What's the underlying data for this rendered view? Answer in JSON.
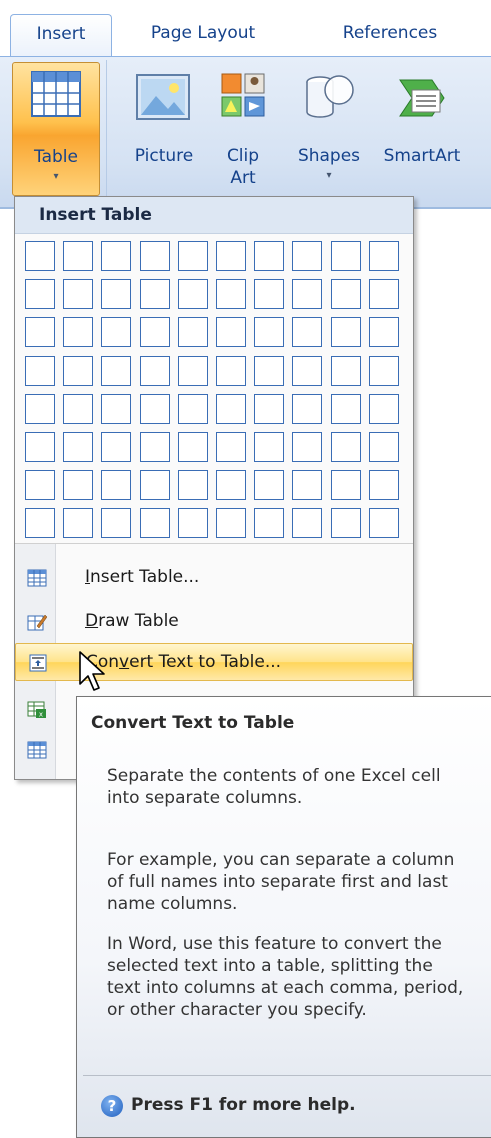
{
  "tabs": [
    {
      "label": "Insert",
      "active": true
    },
    {
      "label": "Page Layout",
      "active": false
    },
    {
      "label": "References",
      "active": false
    }
  ],
  "ribbon": {
    "buttons": [
      {
        "label": "Table",
        "icon": "table-icon",
        "has_dropdown": true,
        "pressed": true
      },
      {
        "label": "Picture",
        "icon": "picture-icon",
        "has_dropdown": false
      },
      {
        "label_line1": "Clip",
        "label_line2": "Art",
        "icon": "clip-art-icon",
        "has_dropdown": false
      },
      {
        "label": "Shapes",
        "icon": "shapes-icon",
        "has_dropdown": true
      },
      {
        "label": "SmartArt",
        "icon": "smartart-icon",
        "has_dropdown": false
      }
    ],
    "dropdown_arrow": "▾"
  },
  "menu": {
    "header": "Insert Table",
    "grid": {
      "columns": 10,
      "rows": 8
    },
    "items": [
      {
        "prefix": "",
        "accel": "I",
        "rest": "nsert Table...",
        "icon": "insert-table-icon",
        "highlighted": false
      },
      {
        "prefix": "",
        "accel": "D",
        "rest": "raw Table",
        "icon": "draw-table-icon",
        "highlighted": false
      },
      {
        "prefix": "Con",
        "accel": "v",
        "rest": "ert Text to Table...",
        "icon": "convert-text-icon",
        "highlighted": true
      },
      {
        "icon": "excel-spreadsheet-icon"
      },
      {
        "icon": "quick-tables-icon"
      }
    ]
  },
  "tooltip": {
    "title": "Convert Text to Table",
    "paragraphs": [
      "Separate the contents of one Excel cell into separate columns.",
      "For example, you can separate a column of full names into separate first and last name columns.",
      "In Word, use this feature to convert the selected text into a table, splitting the text into columns at each comma, period, or other character you specify."
    ],
    "help_text": "Press F1 for more help.",
    "help_icon": "?"
  },
  "colors": {
    "accent_blue": "#15428b",
    "grid_border": "#3a6db5",
    "highlight": "#ffd55a",
    "pressed": "#f9a530"
  }
}
